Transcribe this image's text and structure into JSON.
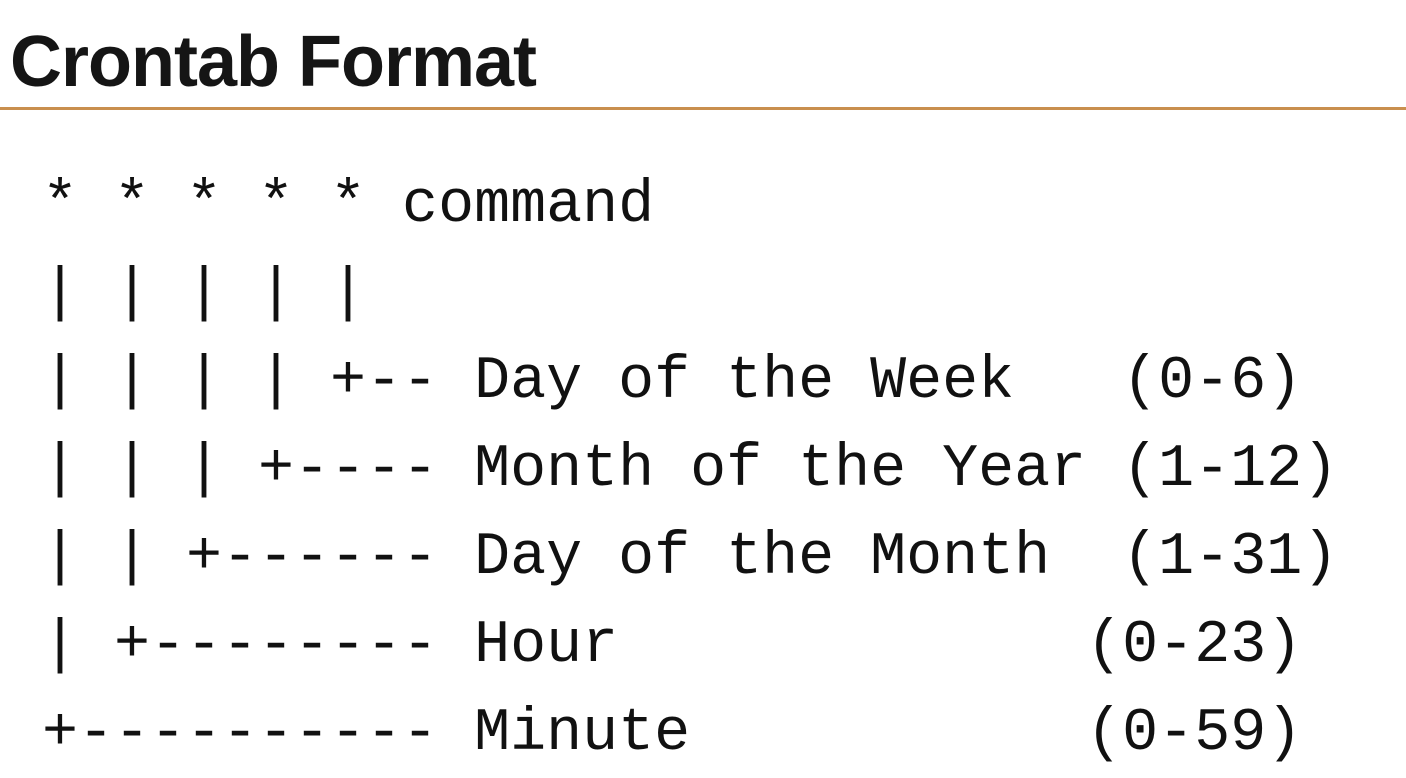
{
  "slide": {
    "title": "Crontab Format"
  },
  "crontab_diagram": {
    "lines": [
      "* * * * * command",
      "| | | | |",
      "| | | | +-- Day of the Week   (0-6)",
      "| | | +---- Month of the Year (1-12)",
      "| | +------ Day of the Month  (1-31)",
      "| +-------- Hour             (0-23)",
      "+---------- Minute           (0-59)"
    ]
  }
}
